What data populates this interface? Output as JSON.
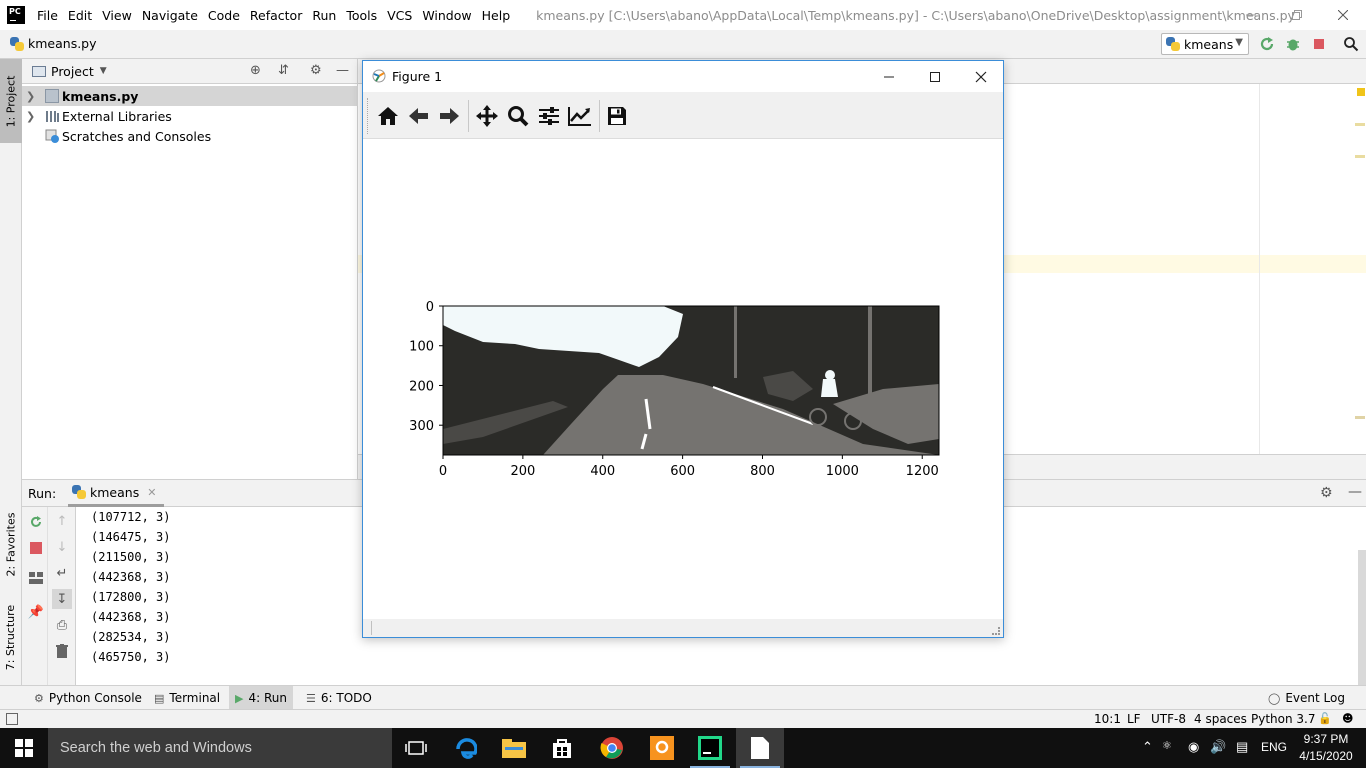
{
  "window": {
    "title": "kmeans.py [C:\\Users\\abano\\AppData\\Local\\Temp\\kmeans.py] - C:\\Users\\abano\\OneDrive\\Desktop\\assignment\\kmeans.py",
    "logo_text": "PC"
  },
  "menu": [
    "File",
    "Edit",
    "View",
    "Navigate",
    "Code",
    "Refactor",
    "Run",
    "Tools",
    "VCS",
    "Window",
    "Help"
  ],
  "navbar": {
    "file": "kmeans.py",
    "run_config": "kmeans"
  },
  "left_strip": {
    "project": "1: Project",
    "favorites": "2: Favorites",
    "structure": "7: Structure"
  },
  "project": {
    "title": "Project",
    "tree": [
      {
        "label": "kmeans.py",
        "icon": "python-file-icon"
      },
      {
        "label": "External Libraries",
        "icon": "library-icon"
      },
      {
        "label": "Scratches and Consoles",
        "icon": "scratches-icon"
      }
    ]
  },
  "run": {
    "label": "Run:",
    "tab": "kmeans",
    "output": [
      "(107712, 3)",
      "(146475, 3)",
      "(211500, 3)",
      "(442368, 3)",
      "(172800, 3)",
      "(442368, 3)",
      "(282534, 3)",
      "(465750, 3)"
    ]
  },
  "tool_tabs": [
    {
      "label": "Python Console",
      "icon": "python-console-icon"
    },
    {
      "label": "Terminal",
      "icon": "terminal-icon"
    },
    {
      "label": "4: Run",
      "icon": "run-icon"
    },
    {
      "label": "6: TODO",
      "icon": "todo-icon"
    }
  ],
  "event_log": "Event Log",
  "status": {
    "position": "10:1",
    "line_sep": "LF",
    "encoding": "UTF-8",
    "indent": "4 spaces",
    "interpreter": "Python 3.7"
  },
  "figure": {
    "title": "Figure 1",
    "toolbar": [
      "home-icon",
      "back-arrow-icon",
      "forward-arrow-icon",
      "pan-icon",
      "zoom-icon",
      "subplots-config-icon",
      "edit-axes-icon",
      "save-icon"
    ]
  },
  "chart_data": {
    "type": "image",
    "title": "",
    "xlabel": "",
    "ylabel": "",
    "xlim": [
      0,
      1242
    ],
    "ylim": [
      375,
      0
    ],
    "x_ticks": [
      0,
      200,
      400,
      600,
      800,
      1000,
      1200
    ],
    "y_ticks": [
      0,
      100,
      200,
      300
    ],
    "palette": [
      "#2b2b28",
      "#757370",
      "#f2f9fa",
      "#ffffff"
    ]
  },
  "taskbar": {
    "search": "Search the web and Windows",
    "lang": "ENG",
    "time": "9:37 PM",
    "date": "4/15/2020"
  },
  "colors": {
    "accent": "#3b8dd8",
    "run_green": "#59a869",
    "stop_red": "#db5860"
  }
}
